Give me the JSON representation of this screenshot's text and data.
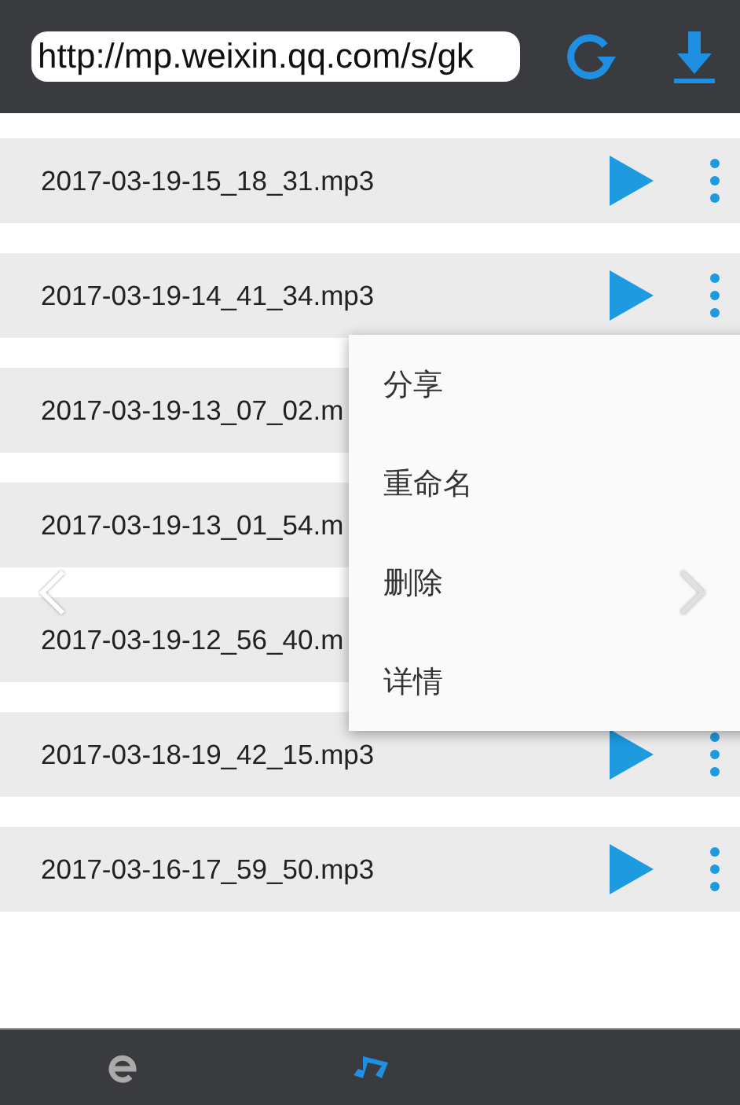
{
  "toolbar": {
    "url": "http://mp.weixin.qq.com/s/gk"
  },
  "recordings": [
    {
      "name": "2017-03-19-15_18_31.mp3",
      "menu_open": false
    },
    {
      "name": "2017-03-19-14_41_34.mp3",
      "menu_open": true
    },
    {
      "name": "2017-03-19-13_07_02.m",
      "menu_open": false
    },
    {
      "name": "2017-03-19-13_01_54.m",
      "menu_open": false
    },
    {
      "name": "2017-03-19-12_56_40.m",
      "menu_open": false
    },
    {
      "name": "2017-03-18-19_42_15.mp3",
      "menu_open": false
    },
    {
      "name": "2017-03-16-17_59_50.mp3",
      "menu_open": false
    }
  ],
  "context_menu": [
    "分享",
    "重命名",
    "删除",
    "详情"
  ],
  "bottom_nav": [
    {
      "kind": "browser",
      "selected": false
    },
    {
      "kind": "music",
      "selected": true
    }
  ]
}
